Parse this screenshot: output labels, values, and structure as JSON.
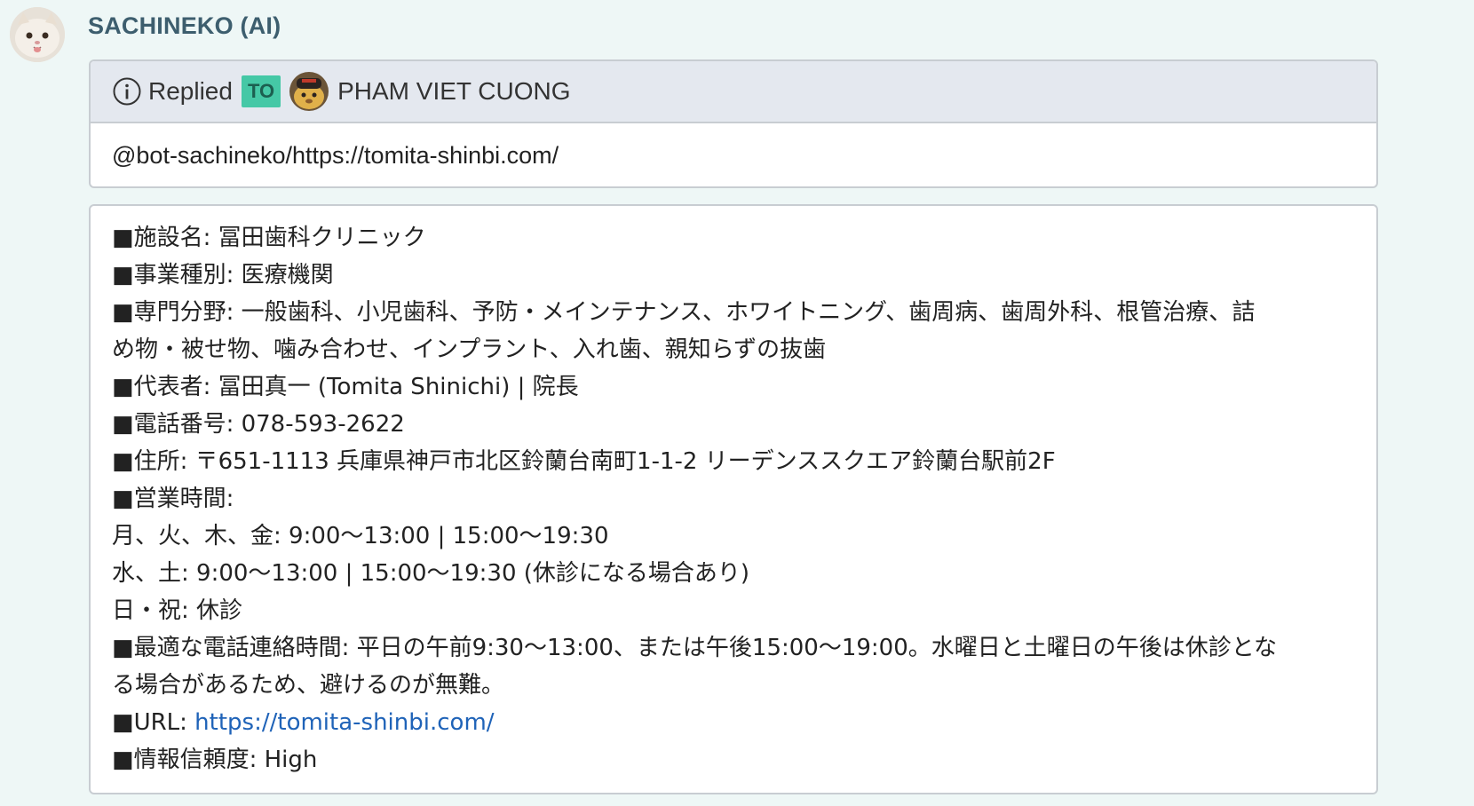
{
  "sender": {
    "name": "SACHINEKO (AI)"
  },
  "reply": {
    "replied_label": "Replied",
    "to_label": "TO",
    "recipient_name": "PHAM VIET CUONG",
    "quoted_text": "@bot-sachineko/https://tomita-shinbi.com/"
  },
  "message": {
    "lines": [
      "■施設名: 冨田歯科クリニック",
      "■事業種別: 医療機関",
      "■専門分野: 一般歯科、小児歯科、予防・メインテナンス、ホワイトニング、歯周病、歯周外科、根管治療、詰",
      "め物・被せ物、噛み合わせ、インプラント、入れ歯、親知らずの抜歯",
      "■代表者: 冨田真一 (Tomita Shinichi) | 院長",
      "■電話番号: 078-593-2622",
      "■住所: 〒651-1113 兵庫県神戸市北区鈴蘭台南町1-1-2 リーデンススクエア鈴蘭台駅前2F",
      "■営業時間:",
      "月、火、木、金: 9:00〜13:00 | 15:00〜19:30",
      "水、土: 9:00〜13:00 | 15:00〜19:30 (休診になる場合あり)",
      "日・祝: 休診",
      "■最適な電話連絡時間: 平日の午前9:30〜13:00、または午後15:00〜19:00。水曜日と土曜日の午後は休診とな",
      "る場合があるため、避けるのが無難。"
    ],
    "url_prefix": "■URL: ",
    "url": "https://tomita-shinbi.com/",
    "reliability": "■情報信頼度: High"
  },
  "colors": {
    "background": "#eef7f6",
    "sender_name": "#3d5e6e",
    "to_badge": "#45c8a6",
    "link": "#1f63b8",
    "header_bg": "#e4e8ef"
  },
  "icons": {
    "info": "info-circle-icon",
    "sender_avatar": "cat-avatar",
    "recipient_avatar": "user-avatar"
  }
}
